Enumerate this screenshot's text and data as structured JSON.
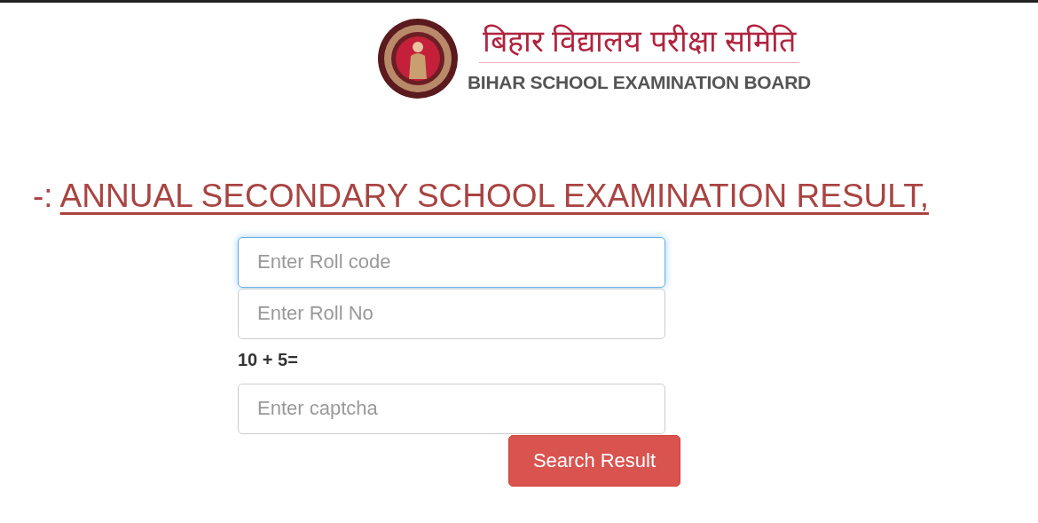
{
  "header": {
    "title_hindi": "बिहार विद्यालय परीक्षा समिति",
    "title_english": "BIHAR SCHOOL EXAMINATION BOARD"
  },
  "heading": {
    "prefix": "-:",
    "link": "ANNUAL SECONDARY SCHOOL EXAMINATION RESULT,"
  },
  "form": {
    "fields": [
      {
        "placeholder": "Enter Roll code",
        "focused": true
      },
      {
        "placeholder": "Enter Roll No",
        "focused": false
      }
    ],
    "captcha_question": "10 + 5=",
    "captcha_field": {
      "placeholder": "Enter captcha",
      "focused": false
    },
    "submit": "Search Result"
  }
}
